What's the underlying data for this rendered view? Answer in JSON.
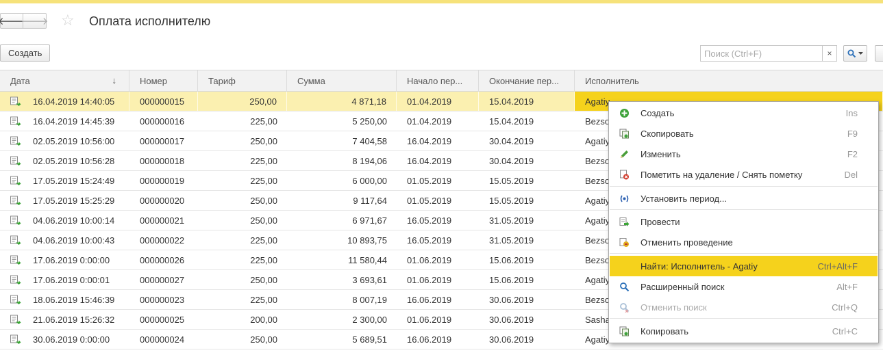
{
  "title": "Оплата исполнителю",
  "toolbar": {
    "create_label": "Создать"
  },
  "search": {
    "placeholder": "Поиск (Ctrl+F)",
    "clear_glyph": "×"
  },
  "table": {
    "columns": [
      "Дата",
      "Номер",
      "Тариф",
      "Сумма",
      "Начало пер...",
      "Окончание пер...",
      "Исполнитель"
    ],
    "sort_indicator": "↓",
    "rows": [
      [
        "16.04.2019 14:40:05",
        "000000015",
        "250,00",
        "4 871,18",
        "01.04.2019",
        "15.04.2019",
        "Agatiy"
      ],
      [
        "16.04.2019 14:45:39",
        "000000016",
        "225,00",
        "5 250,00",
        "01.04.2019",
        "15.04.2019",
        "Bezso"
      ],
      [
        "02.05.2019 10:56:00",
        "000000017",
        "250,00",
        "7 404,58",
        "16.04.2019",
        "30.04.2019",
        "Agatiy"
      ],
      [
        "02.05.2019 10:56:28",
        "000000018",
        "225,00",
        "8 194,06",
        "16.04.2019",
        "30.04.2019",
        "Bezso"
      ],
      [
        "17.05.2019 15:24:49",
        "000000019",
        "225,00",
        "6 000,00",
        "01.05.2019",
        "15.05.2019",
        "Bezso"
      ],
      [
        "17.05.2019 15:25:29",
        "000000020",
        "250,00",
        "9 117,64",
        "01.05.2019",
        "15.05.2019",
        "Agatiy"
      ],
      [
        "04.06.2019 10:00:14",
        "000000021",
        "250,00",
        "6 971,67",
        "16.05.2019",
        "31.05.2019",
        "Agatiy"
      ],
      [
        "04.06.2019 10:00:43",
        "000000022",
        "225,00",
        "10 893,75",
        "16.05.2019",
        "31.05.2019",
        "Bezso"
      ],
      [
        "17.06.2019 0:00:00",
        "000000026",
        "225,00",
        "11 580,44",
        "01.06.2019",
        "15.06.2019",
        "Bezso"
      ],
      [
        "17.06.2019 0:00:01",
        "000000027",
        "250,00",
        "3 693,61",
        "01.06.2019",
        "15.06.2019",
        "Agatiy"
      ],
      [
        "18.06.2019 15:46:39",
        "000000023",
        "225,00",
        "8 007,19",
        "16.06.2019",
        "30.06.2019",
        "Bezso"
      ],
      [
        "21.06.2019 15:26:32",
        "000000025",
        "200,00",
        "2 300,00",
        "01.06.2019",
        "30.06.2019",
        "Sasha"
      ],
      [
        "30.06.2019 0:00:00",
        "000000024",
        "250,00",
        "5 689,51",
        "16.06.2019",
        "30.06.2019",
        "Agatiy"
      ]
    ]
  },
  "context_menu": {
    "items": [
      {
        "label": "Создать",
        "shortcut": "Ins",
        "icon": "plus-icon"
      },
      {
        "label": "Скопировать",
        "shortcut": "F9",
        "icon": "copy-icon"
      },
      {
        "label": "Изменить",
        "shortcut": "F2",
        "icon": "pencil-icon"
      },
      {
        "label": "Пометить на удаление / Снять пометку",
        "shortcut": "Del",
        "icon": "delete-mark-icon"
      },
      {
        "label": "Установить период...",
        "shortcut": "",
        "icon": "period-icon"
      },
      {
        "label": "Провести",
        "shortcut": "",
        "icon": "post-icon"
      },
      {
        "label": "Отменить проведение",
        "shortcut": "",
        "icon": "unpost-icon"
      },
      {
        "label": "Найти: Исполнитель - Agatiy",
        "shortcut": "Ctrl+Alt+F",
        "icon": "",
        "highlighted": true
      },
      {
        "label": "Расширенный поиск",
        "shortcut": "Alt+F",
        "icon": "search-icon"
      },
      {
        "label": "Отменить поиск",
        "shortcut": "Ctrl+Q",
        "icon": "cancel-search-icon",
        "disabled": true
      },
      {
        "label": "Копировать",
        "shortcut": "Ctrl+C",
        "icon": "copy-icon"
      }
    ]
  },
  "colors": {
    "accent": "#f5d21c",
    "selected_row": "#fbf0b0",
    "top_bar": "#f6e27a"
  }
}
